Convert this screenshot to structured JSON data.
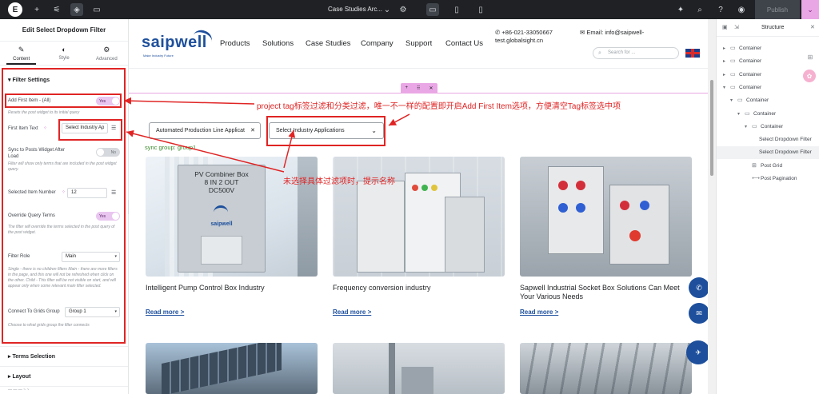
{
  "topbar": {
    "logo": "E",
    "page_title": "Case Studies Arc...",
    "publish_label": "Publish",
    "icons": [
      "plus-icon",
      "sliders-icon",
      "layers-icon",
      "comment-icon",
      "chevron-down-icon",
      "gear-icon",
      "desktop-icon",
      "tablet-icon",
      "mobile-icon",
      "sparkle-icon",
      "search-icon",
      "help-icon",
      "eye-icon"
    ]
  },
  "left_panel": {
    "title": "Edit Select Dropdown Filter",
    "tabs": [
      {
        "label": "Content",
        "icon": "pencil-icon"
      },
      {
        "label": "Style",
        "icon": "contrast-icon"
      },
      {
        "label": "Advanced",
        "icon": "gear-icon"
      }
    ],
    "section_title": "Filter Settings",
    "add_first_item": {
      "label": "Add First Item - (All)",
      "toggle": "Yes",
      "help": "Resets the post widget to its initial query"
    },
    "first_item_text": {
      "label": "First Item Text",
      "value": "Select Industry Ap"
    },
    "sync_posts": {
      "label": "Sync to Posts Widget After Load",
      "toggle": "No",
      "help": "Filter will show only terms that are included in the post widget query."
    },
    "selected_item_number": {
      "label": "Selected Item Number",
      "value": "12"
    },
    "override_query": {
      "label": "Override Query Terms",
      "toggle": "Yes",
      "help": "The filter will override the terms selected in the post query of the post widget."
    },
    "filter_role": {
      "label": "Filter Role",
      "value": "Main",
      "help": "Single - there is no children filters Main - there are more filters in the page, and this one will not be refreshed when click on the other. Child - This filter will be not visible on start, and will appear only when some relevant main filter selected."
    },
    "connect_grids": {
      "label": "Connect To Grids Group",
      "value": "Group 1",
      "help": "Choose to what grids group the filter connects"
    },
    "collapsed_sections": [
      "Terms Selection",
      "Layout"
    ]
  },
  "site": {
    "logo_text": "saipwell",
    "logo_sub": "Make Industry Future",
    "nav": [
      "Products",
      "Solutions",
      "Case Studies",
      "Company",
      "Support",
      "Contact Us"
    ],
    "phone": "+86-021-33050667",
    "email_label": "Email:",
    "email_value": "info@saipwell-",
    "email_value2": "test.globalsight.cn",
    "search_placeholder": "Search for ...",
    "filter1_value": "Automated Production Line Applicat",
    "filter1_clear": "✕",
    "filter2_value": "Select Industry Applications",
    "sync_text": "sync group: group1",
    "products": [
      {
        "title": "Intelligent Pump Control Box Industry",
        "link": "Read more >",
        "box_text": "PV Combiner Box\n8 IN 2 OUT\nDC500V"
      },
      {
        "title": "Frequency conversion industry",
        "link": "Read more >"
      },
      {
        "title": "Sapwell Industrial Socket Box Solutions Can Meet Your Various Needs",
        "link": "Read more >"
      }
    ]
  },
  "annotations": {
    "note1": "project tag标签过滤和分类过滤，唯一不一样的配置即开启Add First Item选项，方便清空Tag标签选中项",
    "note2": "未选择具体过滤项时，提示名称"
  },
  "structure_panel": {
    "title": "Structure",
    "items": [
      {
        "label": "Container",
        "depth": 0,
        "icon": "container-icon"
      },
      {
        "label": "Container",
        "depth": 0,
        "icon": "container-icon"
      },
      {
        "label": "Container",
        "depth": 0,
        "icon": "container-icon"
      },
      {
        "label": "Container",
        "depth": 0,
        "icon": "container-icon"
      },
      {
        "label": "Container",
        "depth": 1,
        "icon": "container-icon"
      },
      {
        "label": "Container",
        "depth": 2,
        "icon": "container-icon"
      },
      {
        "label": "Container",
        "depth": 3,
        "icon": "container-icon"
      },
      {
        "label": "Select Dropdown Filter",
        "depth": 4,
        "icon": ""
      },
      {
        "label": "Select Dropdown Filter",
        "depth": 4,
        "icon": "",
        "selected": true
      },
      {
        "label": "Post Grid",
        "depth": 3,
        "icon": "grid-icon"
      },
      {
        "label": "Post Pagination",
        "depth": 3,
        "icon": "pagination-icon"
      }
    ]
  },
  "colors": {
    "accent_pink": "#e9a7e5",
    "brand_blue": "#1d4f9c",
    "annotation_red": "#e02424",
    "sync_green": "#3a8a2c"
  }
}
